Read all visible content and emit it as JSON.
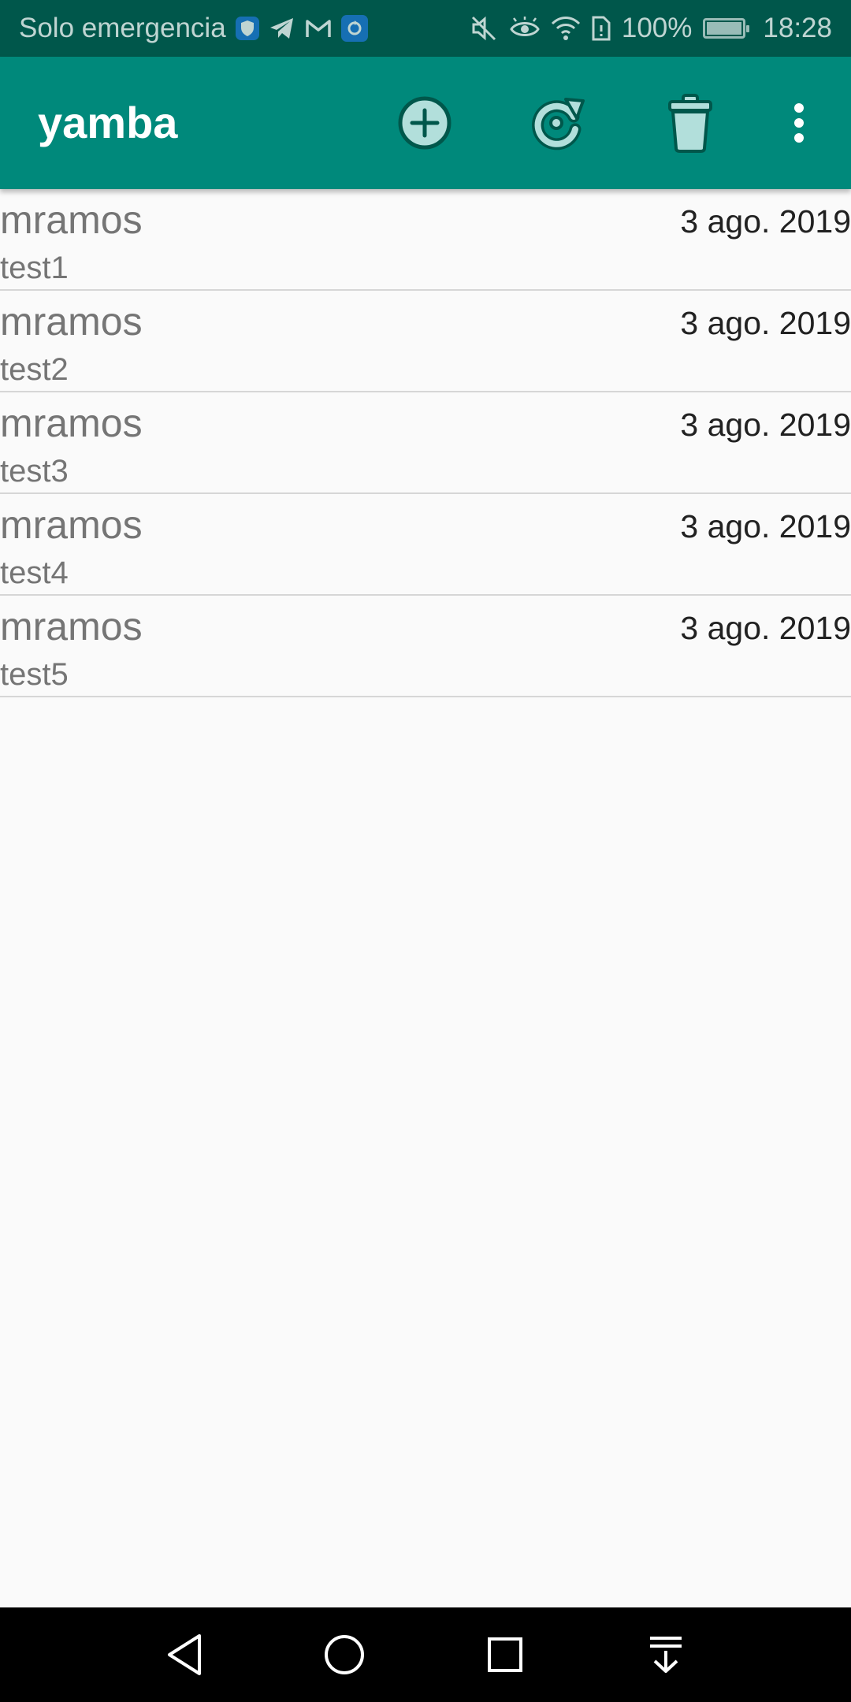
{
  "status_bar": {
    "carrier": "Solo emergencia",
    "battery": "100%",
    "battery_level": 1.0,
    "time": "18:28",
    "notification_icons": [
      "shield-app-icon",
      "telegram-icon",
      "gmail-icon",
      "sync-app-icon"
    ],
    "system_icons": [
      "mute-icon",
      "eye-comfort-icon",
      "wifi-icon",
      "sim-icon",
      "battery-icon"
    ]
  },
  "app_bar": {
    "title": "yamba",
    "actions": [
      "add-icon",
      "refresh-icon",
      "delete-icon",
      "overflow-menu-icon"
    ]
  },
  "timeline": {
    "items": [
      {
        "user": "mramos",
        "date": "3 ago. 2019",
        "message": "test1"
      },
      {
        "user": "mramos",
        "date": "3 ago. 2019",
        "message": "test2"
      },
      {
        "user": "mramos",
        "date": "3 ago. 2019",
        "message": "test3"
      },
      {
        "user": "mramos",
        "date": "3 ago. 2019",
        "message": "test4"
      },
      {
        "user": "mramos",
        "date": "3 ago. 2019",
        "message": "test5"
      }
    ]
  },
  "nav_bar": {
    "buttons": [
      "back-icon",
      "home-icon",
      "recents-icon",
      "notification-pull-icon"
    ]
  },
  "colors": {
    "status_bar": "#00574b",
    "app_bar": "#00897b",
    "icon_fill": "#b2dfdb",
    "icon_stroke": "#00574b",
    "background": "#fafafa"
  }
}
